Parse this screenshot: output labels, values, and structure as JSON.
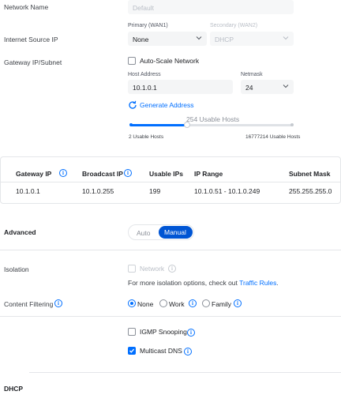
{
  "network_name": {
    "label": "Network Name",
    "placeholder": "Default"
  },
  "internet_source": {
    "label": "Internet Source IP",
    "primary_label": "Primary (WAN1)",
    "primary_value": "None",
    "secondary_label": "Secondary (WAN2)",
    "secondary_value": "DHCP"
  },
  "gateway": {
    "label": "Gateway IP/Subnet",
    "auto_scale_label": "Auto-Scale Network",
    "host_address_label": "Host Address",
    "host_address_value": "10.1.0.1",
    "netmask_label": "Netmask",
    "netmask_value": "24",
    "generate_label": "Generate Address",
    "usable_hosts_label": "254 Usable Hosts",
    "slider_min_label": "2 Usable Hosts",
    "slider_max_label": "16777214 Usable Hosts",
    "slider_fraction": 0.35
  },
  "summary_table": {
    "headers": [
      "Gateway IP",
      "Broadcast IP",
      "Usable IPs",
      "IP Range",
      "Subnet Mask"
    ],
    "row": [
      "10.1.0.1",
      "10.1.0.255",
      "199",
      "10.1.0.51 - 10.1.0.249",
      "255.255.255.0"
    ]
  },
  "advanced": {
    "label": "Advanced",
    "auto_label": "Auto",
    "manual_label": "Manual",
    "selected": "Manual"
  },
  "isolation": {
    "label": "Isolation",
    "network_label": "Network",
    "note_prefix": "For more isolation options, check out ",
    "note_link": "Traffic Rules",
    "note_suffix": "."
  },
  "content_filtering": {
    "label": "Content Filtering",
    "options": [
      "None",
      "Work",
      "Family"
    ],
    "selected": "None"
  },
  "igmp": {
    "label": "IGMP Snooping",
    "checked": false
  },
  "mdns": {
    "label": "Multicast DNS",
    "checked": true
  },
  "dhcp": {
    "label": "DHCP"
  },
  "colors": {
    "accent": "#006fff",
    "muted": "#b9bec6",
    "divider": "#e4e6e9"
  }
}
